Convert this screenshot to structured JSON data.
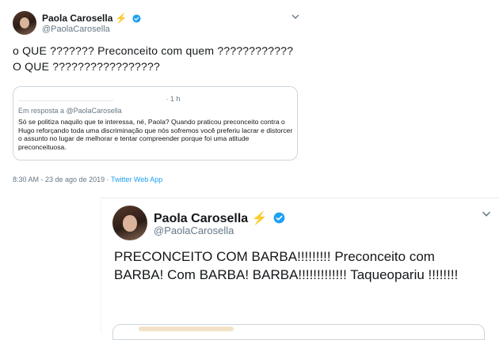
{
  "tweet1": {
    "name": "Paola Carosella",
    "name_emoji": "⚡",
    "handle": "@PaolaCarosella",
    "text": "o QUE ??????? Preconceito com quem ???????????? O QUE ?????????????????",
    "quote": {
      "time": "· 1 h",
      "reply_to": "Em resposta a @PaolaCarosella",
      "text": "Só se politiza naquilo que te interessa, né, Paola? Quando praticou preconceito contra o Hugo reforçando toda uma discriminação que nós sofremos você preferiu lacrar e distorcer o assunto no lugar de melhorar e tentar compreender porque foi uma atitude preconceituosa."
    },
    "timestamp": "8:30 AM - 23 de ago de 2019 · ",
    "app": "Twitter Web App"
  },
  "tweet2": {
    "name": "Paola Carosella",
    "name_emoji": "⚡",
    "handle": "@PaolaCarosella",
    "text": "PRECONCEITO COM BARBA!!!!!!!!!    Preconceito com BARBA! Com BARBA! BARBA!!!!!!!!!!!!!    Taqueopariu !!!!!!!!"
  },
  "icons": {
    "verified": "verified-badge-icon",
    "chevron": "chevron-down-icon"
  },
  "colors": {
    "link": "#1da1f2",
    "muted": "#657786",
    "bolt": "#f5a623"
  }
}
